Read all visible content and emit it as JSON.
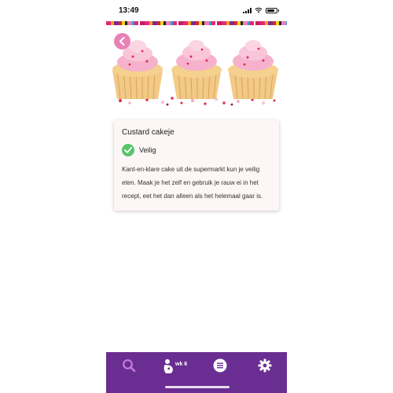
{
  "status_bar": {
    "time": "13:49"
  },
  "colors": {
    "accent": "#6a2d91",
    "safe": "#55c46b",
    "back": "#e882b6",
    "search_active": "#c77ae0"
  },
  "hero": {
    "image_icon": "cupcakes-photo"
  },
  "card": {
    "title": "Custard cakeje",
    "status": "Veilig",
    "description": "Kant-en-klare cake uit de supermarkt kun je veilig eten. Maak je het zelf en gebruik je rauw ei in het recept, eet het dan alleen als het helemaal gaar is."
  },
  "nav": {
    "items": [
      {
        "icon": "search-icon"
      },
      {
        "icon": "pregnancy-icon",
        "label": "wk 6"
      },
      {
        "icon": "list-icon"
      },
      {
        "icon": "gear-icon"
      }
    ]
  }
}
